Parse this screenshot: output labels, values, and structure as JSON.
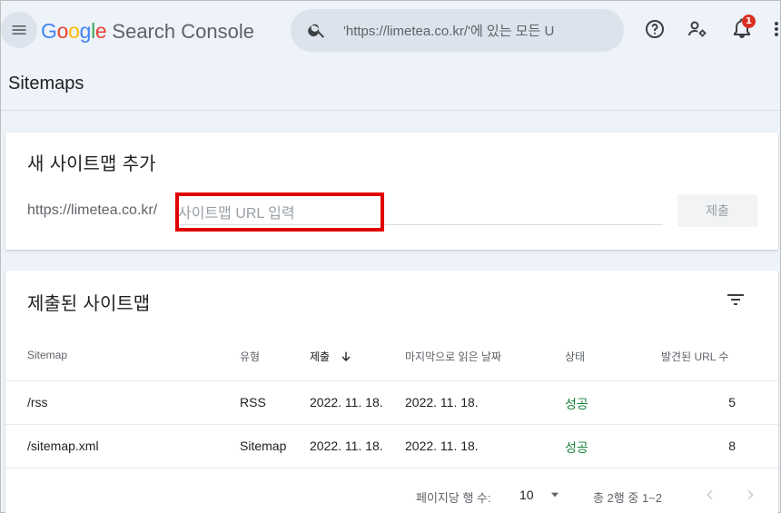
{
  "header": {
    "logo_parts": [
      {
        "text": "G",
        "color": "#4285F4"
      },
      {
        "text": "o",
        "color": "#EA4335"
      },
      {
        "text": "o",
        "color": "#FBBC05"
      },
      {
        "text": "g",
        "color": "#4285F4"
      },
      {
        "text": "l",
        "color": "#34A853"
      },
      {
        "text": "e",
        "color": "#EA4335"
      }
    ],
    "product_name": "Search Console",
    "search_value": "'https://limetea.co.kr/'에 있는 모든 U",
    "notification_count": "1",
    "icons": [
      "menu-icon",
      "search-icon",
      "help-icon",
      "manage-users-icon",
      "notifications-icon",
      "more-vert-icon"
    ]
  },
  "page": {
    "title": "Sitemaps"
  },
  "add_sitemap": {
    "title": "새 사이트맵 추가",
    "prefix": "https://limetea.co.kr/",
    "placeholder": "사이트맵 URL 입력",
    "submit_label": "제출",
    "highlight_color": "#e00000"
  },
  "submitted": {
    "title": "제출된 사이트맵",
    "columns": [
      "Sitemap",
      "유형",
      "제출",
      "마지막으로 읽은 날짜",
      "상태",
      "발견된 URL 수"
    ],
    "rows": [
      {
        "sitemap": "/rss",
        "type": "RSS",
        "submitted": "2022. 11. 18.",
        "last_read": "2022. 11. 18.",
        "status": "성공",
        "urls": "5"
      },
      {
        "sitemap": "/sitemap.xml",
        "type": "Sitemap",
        "submitted": "2022. 11. 18.",
        "last_read": "2022. 11. 18.",
        "status": "성공",
        "urls": "8"
      }
    ],
    "pagination": {
      "rows_per_page_label": "페이지당 행 수:",
      "rows_per_page_value": "10",
      "range_label": "총 2행 중 1~2"
    },
    "status_color": "#188038"
  }
}
